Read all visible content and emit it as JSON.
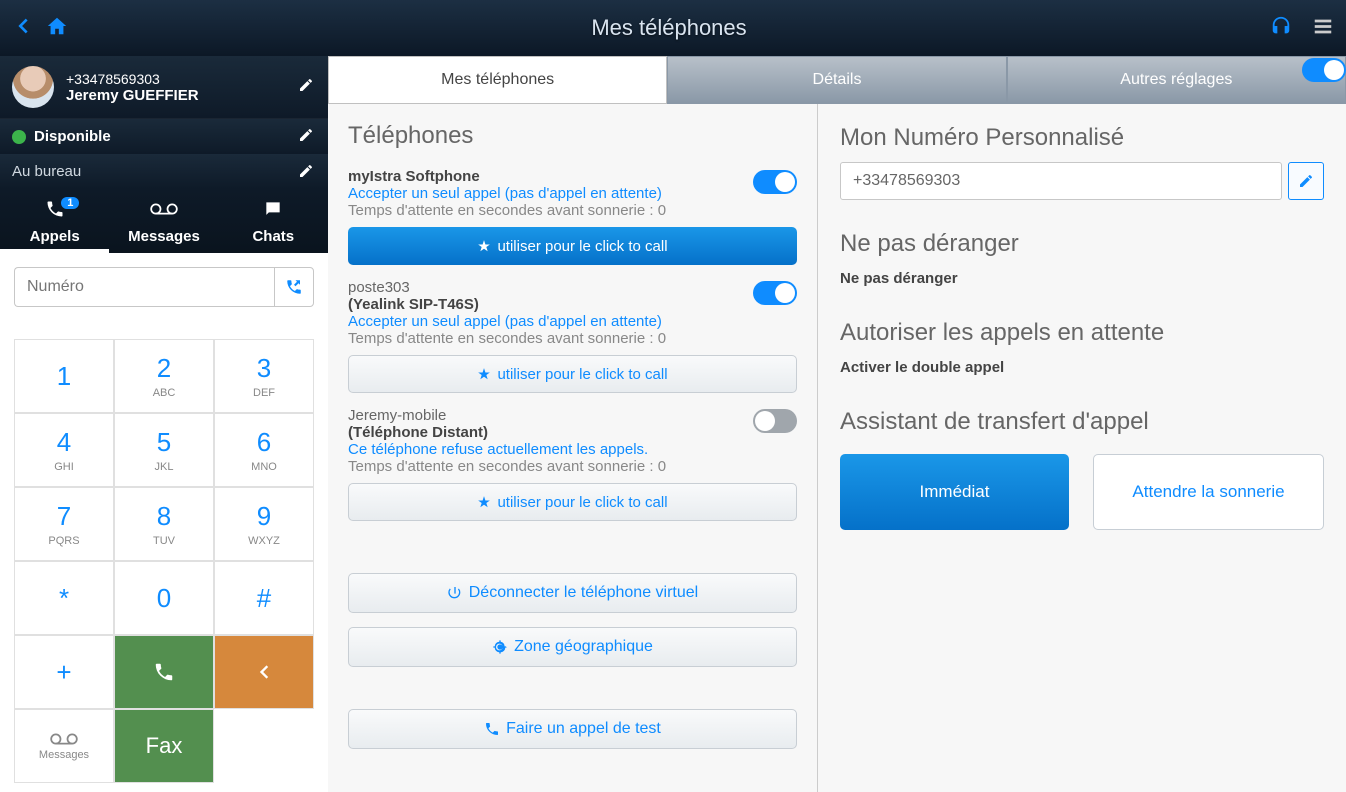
{
  "header": {
    "title": "Mes téléphones"
  },
  "user": {
    "phone": "+33478569303",
    "name": "Jeremy GUEFFIER",
    "status": "Disponible",
    "location": "Au bureau"
  },
  "sidebar_tabs": {
    "calls": "Appels",
    "calls_badge": "1",
    "messages": "Messages",
    "chats": "Chats"
  },
  "dial": {
    "placeholder": "Numéro",
    "keys": [
      {
        "digit": "1",
        "letters": ""
      },
      {
        "digit": "2",
        "letters": "ABC"
      },
      {
        "digit": "3",
        "letters": "DEF"
      },
      {
        "digit": "4",
        "letters": "GHI"
      },
      {
        "digit": "5",
        "letters": "JKL"
      },
      {
        "digit": "6",
        "letters": "MNO"
      },
      {
        "digit": "7",
        "letters": "PQRS"
      },
      {
        "digit": "8",
        "letters": "TUV"
      },
      {
        "digit": "9",
        "letters": "WXYZ"
      },
      {
        "digit": "*",
        "letters": ""
      },
      {
        "digit": "0",
        "letters": ""
      },
      {
        "digit": "#",
        "letters": ""
      }
    ],
    "messages_label": "Messages",
    "fax_label": "Fax"
  },
  "ptabs": {
    "t1": "Mes téléphones",
    "t2": "Détails",
    "t3": "Autres réglages"
  },
  "phones": {
    "title": "Téléphones",
    "click_to_call": "utiliser pour le click to call",
    "items": [
      {
        "name": "myIstra Softphone",
        "model": "",
        "accept": "Accepter un seul appel (pas d'appel en attente)",
        "wait": "Temps d'attente en secondes avant sonnerie : 0",
        "on": true,
        "primary": true
      },
      {
        "name": "poste303",
        "model": "(Yealink SIP-T46S)",
        "accept": "Accepter un seul appel (pas d'appel en attente)",
        "wait": "Temps d'attente en secondes avant sonnerie : 0",
        "on": true,
        "primary": false
      },
      {
        "name": "Jeremy-mobile",
        "model": "(Téléphone Distant)",
        "accept": "Ce téléphone refuse actuellement les appels.",
        "wait": "Temps d'attente en secondes avant sonnerie : 0",
        "on": false,
        "primary": false
      }
    ]
  },
  "actions": {
    "disconnect": "Déconnecter le téléphone virtuel",
    "geo": "Zone géographique",
    "test": "Faire un appel de test"
  },
  "right": {
    "pnum_title": "Mon Numéro Personnalisé",
    "pnum_value": "+33478569303",
    "dnd_title": "Ne pas déranger",
    "dnd_label": "Ne pas déranger",
    "dnd_on": false,
    "waiting_title": "Autoriser les appels en attente",
    "waiting_label": "Activer le double appel",
    "waiting_on": true,
    "assist_title": "Assistant de transfert d'appel",
    "immediate": "Immédiat",
    "ring": "Attendre la sonnerie"
  }
}
